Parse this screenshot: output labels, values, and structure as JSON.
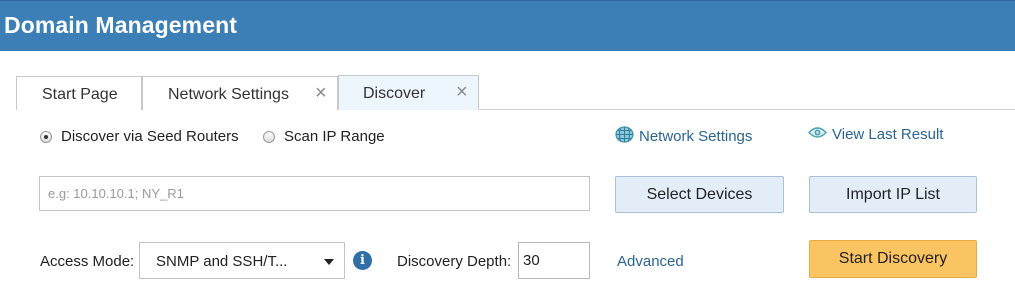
{
  "header": {
    "title": "Domain Management"
  },
  "tabs": [
    {
      "label": "Start Page",
      "closable": false
    },
    {
      "label": "Network Settings",
      "closable": true
    },
    {
      "label": "Discover",
      "closable": true,
      "active": true
    }
  ],
  "discover": {
    "mode_options": [
      {
        "label": "Discover via Seed Routers",
        "checked": true
      },
      {
        "label": "Scan IP Range",
        "checked": false
      }
    ],
    "links": {
      "network_settings": "Network Settings",
      "view_last_result": "View Last Result",
      "advanced": "Advanced"
    },
    "seed_input": {
      "value": "",
      "placeholder": "e.g: 10.10.10.1; NY_R1"
    },
    "buttons": {
      "select_devices": "Select Devices",
      "import_ip_list": "Import IP List",
      "start_discovery": "Start Discovery"
    },
    "access_mode": {
      "label": "Access Mode:",
      "selected": "SNMP and SSH/T..."
    },
    "discovery_depth": {
      "label": "Discovery Depth:",
      "value": "30"
    }
  },
  "icons": {
    "network": "globe-grid-icon",
    "view": "eye-icon",
    "info": "info-icon",
    "close": "close-icon",
    "dropdown": "caret-down-icon"
  },
  "colors": {
    "header_bg": "#3c7fb7",
    "link": "#2a6496",
    "button_bg": "#e3edf8",
    "primary_button_bg": "#fbc462",
    "active_tab_bg": "#eef6fd"
  }
}
